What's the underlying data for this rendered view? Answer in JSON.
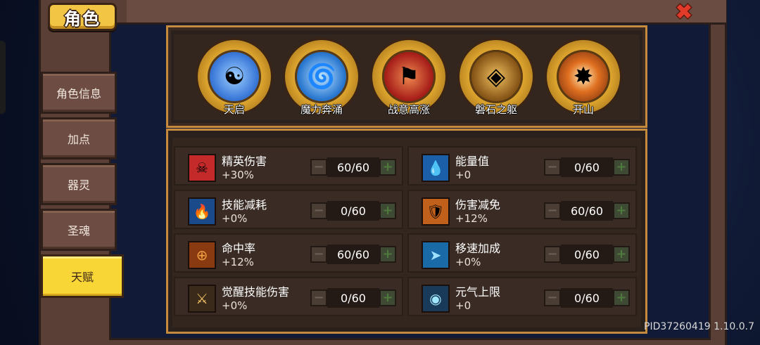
{
  "title": "角色",
  "nav": [
    {
      "label": "角色信息",
      "active": false
    },
    {
      "label": "加点",
      "active": false
    },
    {
      "label": "器灵",
      "active": false
    },
    {
      "label": "圣魂",
      "active": false
    },
    {
      "label": "天赋",
      "active": true
    }
  ],
  "skills": [
    {
      "name": "天启",
      "icon": "meditation-icon",
      "color": "#3a78d8"
    },
    {
      "name": "魔力奔涌",
      "icon": "mana-swirl-icon",
      "color": "#2a78d0"
    },
    {
      "name": "战意高涨",
      "icon": "war-flag-icon",
      "color": "#a8201a"
    },
    {
      "name": "磐石之躯",
      "icon": "stone-body-icon",
      "color": "#8a5818"
    },
    {
      "name": "开山",
      "icon": "mountain-split-icon",
      "color": "#8a3a10"
    }
  ],
  "stats": [
    {
      "name": "精英伤害",
      "value": "+30%",
      "count": "60/60",
      "icon": "demon-skull-icon"
    },
    {
      "name": "能量值",
      "value": "+0",
      "count": "0/60",
      "icon": "energy-drop-icon"
    },
    {
      "name": "技能减耗",
      "value": "+0%",
      "count": "0/60",
      "icon": "blue-flame-icon"
    },
    {
      "name": "伤害减免",
      "value": "+12%",
      "count": "60/60",
      "icon": "shield-icon"
    },
    {
      "name": "命中率",
      "value": "+12%",
      "count": "60/60",
      "icon": "crosshair-icon"
    },
    {
      "name": "移速加成",
      "value": "+0%",
      "count": "0/60",
      "icon": "boot-icon"
    },
    {
      "name": "觉醒技能伤害",
      "value": "+0%",
      "count": "0/60",
      "icon": "sword-icon"
    },
    {
      "name": "元气上限",
      "value": "+0",
      "count": "0/60",
      "icon": "orb-icon"
    }
  ],
  "stepper": {
    "minus": "−",
    "plus": "+"
  },
  "close_label": "✖",
  "build_info": "PID37260419 1.10.0.7"
}
